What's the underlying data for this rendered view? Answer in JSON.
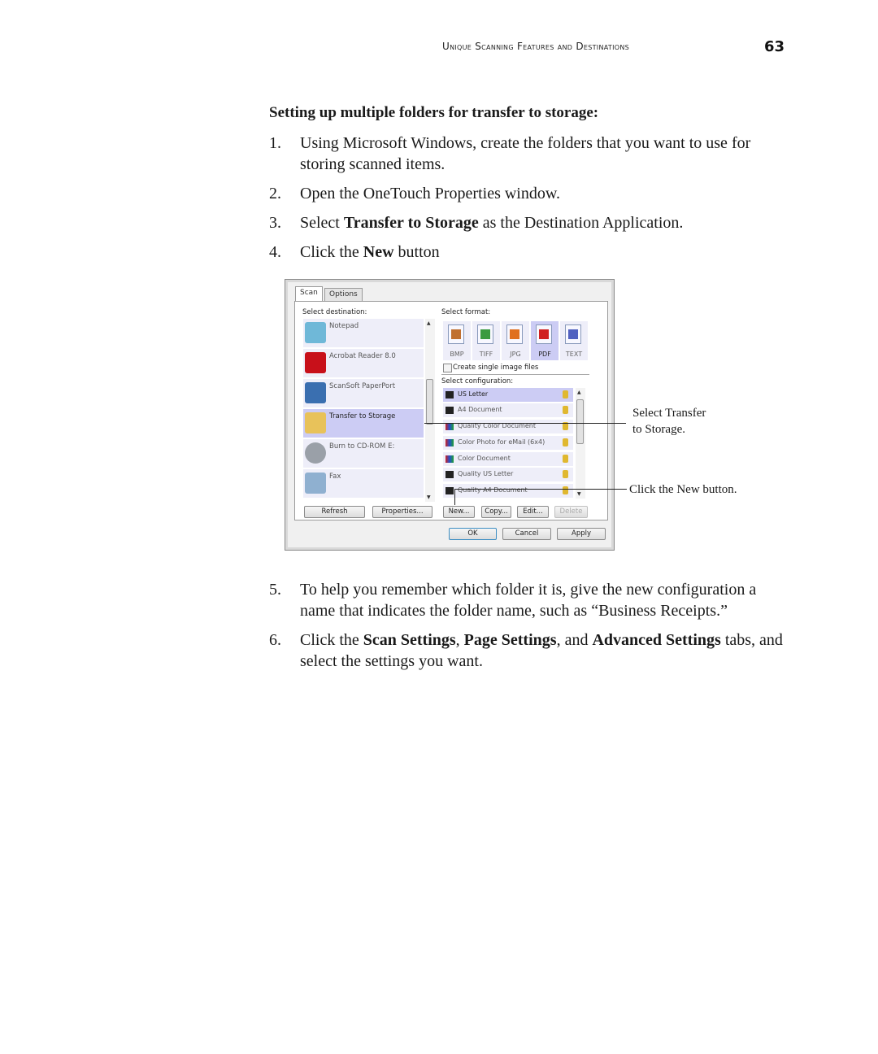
{
  "header": {
    "running_head": "Unique Scanning Features and Destinations",
    "page_number": "63"
  },
  "section_heading": "Setting up multiple folders for transfer to storage:",
  "steps": [
    {
      "num": "1.",
      "pre": "Using Microsoft Windows, create the folders that you want to use for storing scanned items.",
      "bold": "",
      "post": ""
    },
    {
      "num": "2.",
      "pre": "Open the OneTouch Properties window.",
      "bold": "",
      "post": ""
    },
    {
      "num": "3.",
      "pre": "Select ",
      "bold": "Transfer to Storage",
      "post": " as the Destination Application."
    },
    {
      "num": "4.",
      "pre": "Click the ",
      "bold": "New",
      "post": " button"
    },
    {
      "num": "5.",
      "pre": "To help you remember which folder it is, give the new configuration a name that indicates the folder name, such as “Business Receipts.”",
      "bold": "",
      "post": ""
    }
  ],
  "step6": {
    "num": "6.",
    "t1": "Click the ",
    "b1": "Scan Settings",
    "t2": ", ",
    "b2": "Page Settings",
    "t3": ", and ",
    "b3": "Advanced Settings",
    "t4": " tabs, and select the settings you want."
  },
  "dialog": {
    "tabs": [
      {
        "label": "Scan",
        "active": true
      },
      {
        "label": "Options",
        "active": false
      }
    ],
    "select_destination_label": "Select destination:",
    "destinations": [
      {
        "name": "Notepad",
        "icon": "notepad-icon",
        "color": "#6fb8d8",
        "selected": false
      },
      {
        "name": "Acrobat Reader 8.0",
        "icon": "acrobat-icon",
        "color": "#c8101a",
        "selected": false
      },
      {
        "name": "ScanSoft PaperPort",
        "icon": "paperport-icon",
        "color": "#3a6fb0",
        "selected": false
      },
      {
        "name": "Transfer to Storage",
        "icon": "folder-storage-icon",
        "color": "#e8c25a",
        "selected": true
      },
      {
        "name": "Burn to CD-ROM  E:",
        "icon": "cd-rom-icon",
        "color": "#9aa0a8",
        "selected": false
      },
      {
        "name": "Fax",
        "icon": "fax-icon",
        "color": "#8fb0d0",
        "selected": false
      }
    ],
    "select_format_label": "Select format:",
    "formats": [
      {
        "name": "BMP",
        "icon": "bmp-icon",
        "color": "#c07030",
        "selected": false
      },
      {
        "name": "TIFF",
        "icon": "tiff-icon",
        "color": "#3a9a40",
        "selected": false
      },
      {
        "name": "JPG",
        "icon": "jpg-icon",
        "color": "#e07020",
        "selected": false
      },
      {
        "name": "PDF",
        "icon": "pdf-icon",
        "color": "#d02020",
        "selected": true
      },
      {
        "name": "TEXT",
        "icon": "text-icon",
        "color": "#5060c0",
        "selected": false
      }
    ],
    "single_image_checkbox_label": "Create single image files",
    "single_image_checked": false,
    "select_configuration_label": "Select configuration:",
    "configurations": [
      {
        "name": "US Letter",
        "type": "bw",
        "selected": true
      },
      {
        "name": "A4 Document",
        "type": "bw",
        "selected": false
      },
      {
        "name": "Quality Color Document",
        "type": "color",
        "selected": false
      },
      {
        "name": "Color Photo for eMail (6x4)",
        "type": "color",
        "selected": false
      },
      {
        "name": "Color Document",
        "type": "color",
        "selected": false
      },
      {
        "name": "Quality US Letter",
        "type": "bw",
        "selected": false
      },
      {
        "name": "Quality A4 Document",
        "type": "bw",
        "selected": false
      }
    ],
    "buttons": {
      "refresh": "Refresh",
      "properties": "Properties...",
      "new": "New...",
      "copy": "Copy...",
      "edit": "Edit...",
      "delete": "Delete",
      "ok": "OK",
      "cancel": "Cancel",
      "apply": "Apply"
    }
  },
  "callouts": {
    "select_transfer_line1": "Select Transfer",
    "select_transfer_line2": "to Storage.",
    "click_new": "Click the New button."
  }
}
